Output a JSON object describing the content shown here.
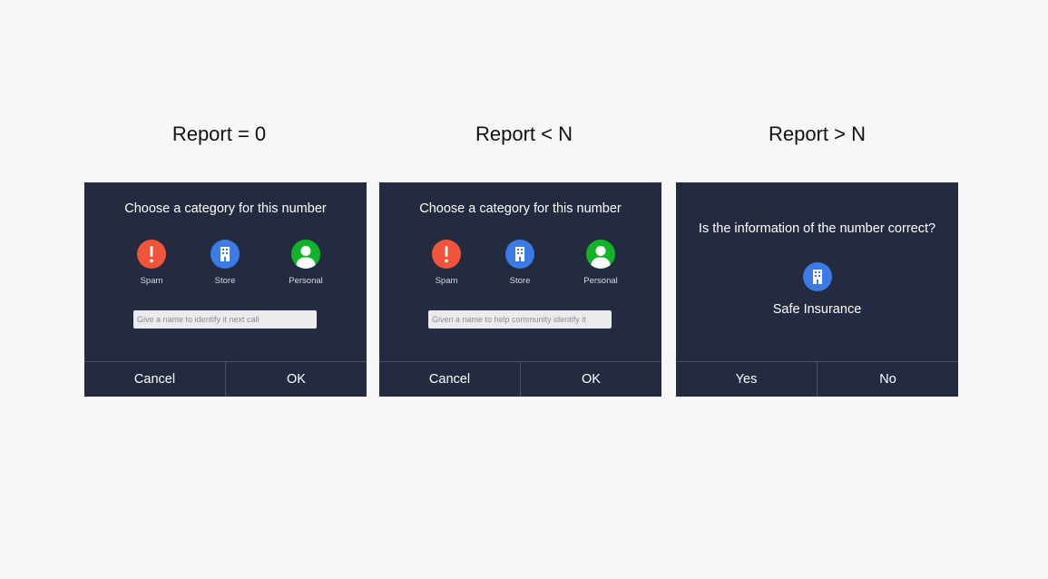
{
  "columns": [
    {
      "title": "Report = 0"
    },
    {
      "title": "Report < N"
    },
    {
      "title": "Report > N"
    }
  ],
  "dialog1": {
    "heading": "Choose a category for this number",
    "categories": [
      {
        "label": "Spam",
        "icon": "exclamation-icon",
        "color": "#f2533b"
      },
      {
        "label": "Store",
        "icon": "building-icon",
        "color": "#3b7be6"
      },
      {
        "label": "Personal",
        "icon": "person-icon",
        "color": "#11b329"
      }
    ],
    "input": {
      "placeholder": "Give a name to identify it next call",
      "value": ""
    },
    "cancel_label": "Cancel",
    "ok_label": "OK"
  },
  "dialog2": {
    "heading": "Choose a category for this number",
    "categories": [
      {
        "label": "Spam",
        "icon": "exclamation-icon",
        "color": "#f2533b"
      },
      {
        "label": "Store",
        "icon": "building-icon",
        "color": "#3b7be6"
      },
      {
        "label": "Personal",
        "icon": "person-icon",
        "color": "#11b329"
      }
    ],
    "input": {
      "placeholder": "Given a name to help community identify it",
      "value": ""
    },
    "cancel_label": "Cancel",
    "ok_label": "OK"
  },
  "dialog3": {
    "question": "Is the information of the number correct?",
    "icon": "building-icon",
    "icon_color": "#3b7be6",
    "company": "Safe Insurance",
    "yes_label": "Yes",
    "no_label": "No"
  },
  "colors": {
    "page_background": "#f7f7f7",
    "dialog_background": "#242a3f",
    "divider": "#4a5067"
  }
}
